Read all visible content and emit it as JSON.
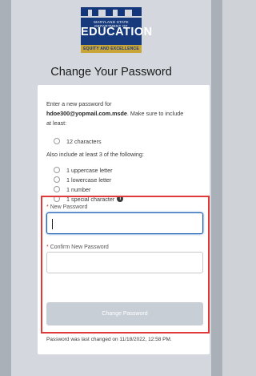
{
  "logo": {
    "small_text": "MARYLAND STATE DEPARTMENT OF",
    "big_text": "EDUCATION",
    "tagline": "EQUITY AND EXCELLENCE"
  },
  "page_title": "Change Your Password",
  "instructions": {
    "line1": "Enter a new password for",
    "username": "hdoe300@yopmail.com.msde",
    "line2_suffix": ". Make sure to include",
    "line3": "at least:"
  },
  "requirements": {
    "primary": "12 characters",
    "also_heading": "Also include at least 3 of the following:",
    "items": [
      "1 uppercase letter",
      "1 lowercase letter",
      "1 number",
      "1 special character"
    ]
  },
  "form": {
    "new_password_label": "New Password",
    "confirm_password_label": "Confirm New Password",
    "required_mark": "*",
    "new_password_value": "",
    "confirm_password_value": "",
    "submit_label": "Change Password"
  },
  "footer": "Password was last changed on 11/18/2022, 12:58 PM.",
  "colors": {
    "accent": "#173a7d",
    "highlight": "#e0393a",
    "focus": "#1b5fb5"
  }
}
